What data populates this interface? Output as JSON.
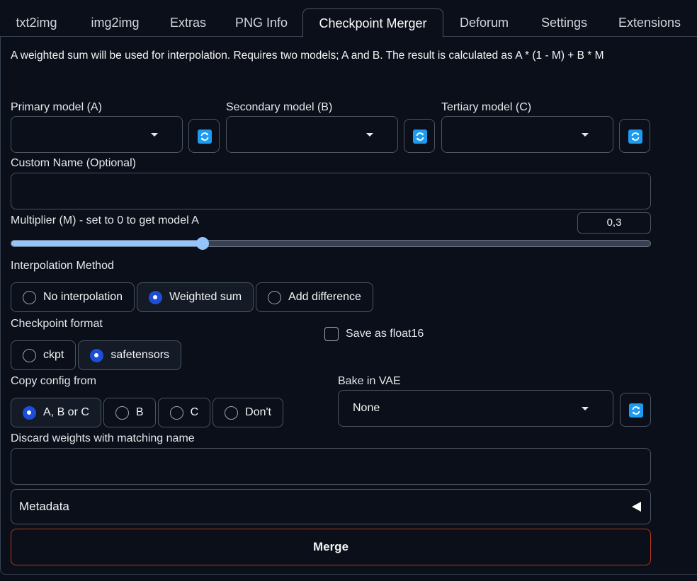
{
  "tabs": [
    {
      "label": "txt2img"
    },
    {
      "label": "img2img"
    },
    {
      "label": "Extras"
    },
    {
      "label": "PNG Info"
    },
    {
      "label": "Checkpoint Merger",
      "active": true
    },
    {
      "label": "Deforum"
    },
    {
      "label": "Settings"
    },
    {
      "label": "Extensions"
    }
  ],
  "description": "A weighted sum will be used for interpolation. Requires two models; A and B. The result is calculated as A * (1 - M) + B * M",
  "models": {
    "primary_label": "Primary model (A)",
    "primary_value": "",
    "secondary_label": "Secondary model (B)",
    "secondary_value": "",
    "tertiary_label": "Tertiary model (C)",
    "tertiary_value": ""
  },
  "custom_name": {
    "label": "Custom Name (Optional)",
    "value": ""
  },
  "multiplier": {
    "label": "Multiplier (M) - set to 0 to get model A",
    "display": "0,3",
    "value": 0.3
  },
  "interpolation": {
    "label": "Interpolation Method",
    "options": [
      "No interpolation",
      "Weighted sum",
      "Add difference"
    ],
    "selected": "Weighted sum"
  },
  "checkpoint_format": {
    "label": "Checkpoint format",
    "options": [
      "ckpt",
      "safetensors"
    ],
    "selected": "safetensors"
  },
  "save_float16": {
    "label": "Save as float16",
    "checked": false
  },
  "copy_config": {
    "label": "Copy config from",
    "options": [
      "A, B or C",
      "B",
      "C",
      "Don't"
    ],
    "selected": "A, B or C"
  },
  "bake_vae": {
    "label": "Bake in VAE",
    "value": "None"
  },
  "discard_weights": {
    "label": "Discard weights with matching name",
    "value": ""
  },
  "metadata": {
    "label": "Metadata"
  },
  "merge_button": {
    "label": "Merge"
  },
  "colors": {
    "accent": "#93c5fd",
    "radio_selected": "#1d4ed8",
    "refresh_icon": "#1d9bf0",
    "merge_border": "#b4381c"
  },
  "icons": {
    "refresh": "refresh-icon",
    "caret": "chevron-down-icon",
    "accordion": "triangle-left-icon"
  }
}
